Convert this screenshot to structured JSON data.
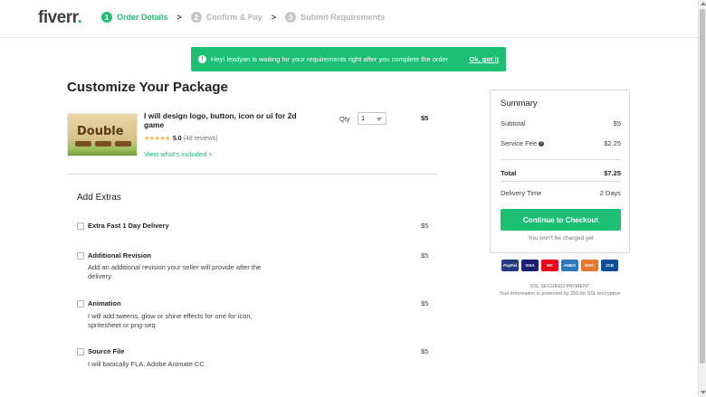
{
  "header": {
    "logo": "fiverr",
    "logo_dot": ".",
    "steps": [
      {
        "num": "1",
        "label": "Order Details"
      },
      {
        "num": "2",
        "label": "Confirm & Pay"
      },
      {
        "num": "3",
        "label": "Submit Requirements"
      }
    ],
    "chevron": ">"
  },
  "banner": {
    "icon": "!",
    "text": "Hey! lexdyan is waiting for your requirements right after you complete the order",
    "link": "Ok, got it"
  },
  "page_title": "Customize Your Package",
  "gig": {
    "thumb_word": "Double",
    "title": "I will design logo, button, icon or ui for 2d game",
    "stars": "★★★★★",
    "rating": "5.0",
    "reviews": "(48 reviews)",
    "included_link": "View what's included ˅",
    "qty_label": "Qty",
    "qty_value": "1",
    "price": "$5"
  },
  "extras": {
    "title": "Add Extras",
    "items": [
      {
        "name": "Extra Fast 1 Day Delivery",
        "desc": "",
        "price": "$5"
      },
      {
        "name": "Additional Revision",
        "desc": "Add an additional revision your seller will provide after the delivery.",
        "price": "$5"
      },
      {
        "name": "Animation",
        "desc": "I will add tweens, glow or shine effects for one for icon, spritesheet or png-seq",
        "price": "$5"
      },
      {
        "name": "Source File",
        "desc": "I will basically FLA, Adobe Animate CC",
        "price": "$5"
      }
    ]
  },
  "summary": {
    "title": "Summary",
    "subtotal_label": "Subtotal",
    "subtotal": "$5",
    "fee_label": "Service Fee",
    "fee_icon": "?",
    "fee": "$2.25",
    "total_label": "Total",
    "total": "$7.25",
    "delivery_label": "Delivery Time",
    "delivery": "2 Days",
    "checkout_label": "Continue to Checkout",
    "no_charge": "You won't be charged yet"
  },
  "payments": [
    {
      "label": "PayPal",
      "color": "#253b80"
    },
    {
      "label": "VISA",
      "color": "#1a1f71"
    },
    {
      "label": "MC",
      "color": "#eb001b"
    },
    {
      "label": "AMEX",
      "color": "#2e77bc"
    },
    {
      "label": "DISC",
      "color": "#e6772e"
    },
    {
      "label": "JCB",
      "color": "#0e4c96"
    }
  ],
  "ssl": {
    "title": "SSL SECURED PAYMENT",
    "text": "Your information is protected by 256-bit SSL encryption"
  },
  "colors": {
    "brand": "#1dbf73",
    "text": "#222325",
    "muted": "#74767e"
  }
}
